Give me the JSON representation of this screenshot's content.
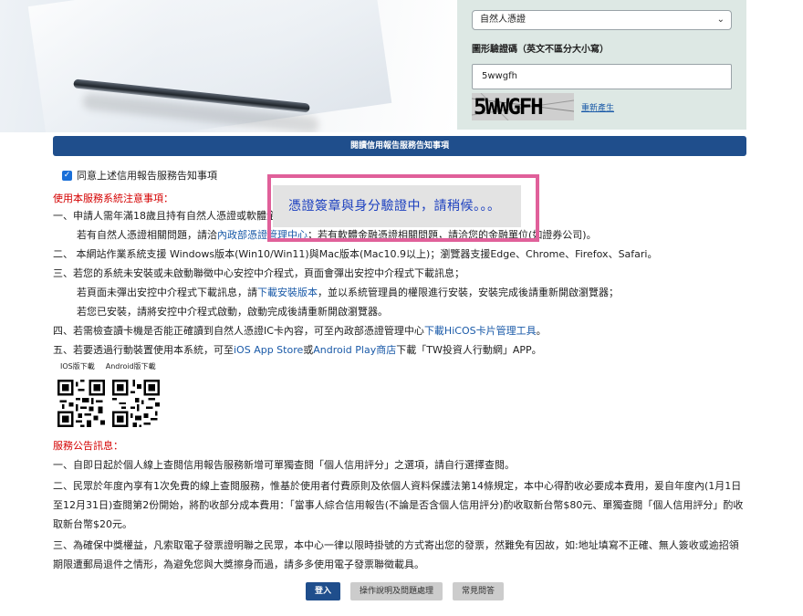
{
  "login": {
    "certificate_type": "自然人憑證",
    "captcha_label": "圖形驗證碼（英文不區分大小寫）",
    "captcha_value": "5wwgfh",
    "captcha_image_text": "5WWGFH",
    "regenerate_label": "重新產生"
  },
  "notice_bar": "閱讀信用報告服務告知事項",
  "agree_label": "同意上述信用報告服務告知事項",
  "system_notes": {
    "title": "使用本服務系統注意事項：",
    "lines": [
      "一、申請人需年滿18歲且持有自然人憑證或軟體金融",
      "若有自然人憑證相關問題，請洽",
      "內政部憑證管理中心",
      "；若有軟體金融憑證相關問題，請洽您的金融單位(如證券公司)。",
      "二、 本網站作業系統支援 Windows版本(Win10/Win11)與Mac版本(Mac10.9以上)；瀏覽器支援Edge、Chrome、Firefox、Safari。",
      "三、若您的系統未安裝或未啟動聯徵中心安控中介程式，頁面會彈出安控中介程式下載訊息；",
      "若頁面未彈出安控中介程式下載訊息，請",
      "下載安裝版本",
      "，並以系統管理員的權限進行安裝，安裝完成後請重新開啟瀏覽器；",
      "若您已安裝，請將安控中介程式啟動，啟動完成後請重新開啟瀏覽器。",
      "四、若需檢查讀卡機是否能正確讀到自然人憑證IC卡內容，可至內政部憑證管理中心",
      "下載HiCOS卡片管理工具",
      "。",
      "五、若要透過行動裝置使用本系統，可至",
      "iOS App Store",
      "或",
      "Android Play商店",
      "下載「TW投資人行動網」APP。"
    ]
  },
  "qr": {
    "ios_label": "IOS版下載",
    "android_label": "Android版下載"
  },
  "service_notes": {
    "title": "服務公告訊息：",
    "lines": [
      "一、自即日起於個人線上查閱信用報告服務新增可單獨查閱「個人信用評分」之選項，請自行選擇查閱。",
      "二、民眾於年度內享有1次免費的線上查閱服務，惟基於使用者付費原則及依個人資料保護法第14條規定，本中心得酌收必要成本費用，爰自年度內(1月1日至12月31日)查閱第2份開始，將酌收部分成本費用：「當事人綜合信用報告(不論是否含個人信用評分)酌收取新台幣$80元、單獨查閱「個人信用評分」酌收取新台幣$20元。",
      "三、為確保中獎權益，凡索取電子發票證明聯之民眾，本中心一律以限時掛號的方式寄出您的發票，然難免有因故，如:地址填寫不正確、無人簽收或逾招領期限遭郵局退件之情形，為避免您與大獎擦身而過，請多多使用電子發票聯徵載具。"
    ]
  },
  "loading_message": "憑證簽章與身分驗證中，請稍候。。。",
  "buttons": {
    "login": "登入",
    "help": "操作說明及問題處理",
    "faq": "常見問答"
  },
  "colors": {
    "brand_blue": "#1f4e8c",
    "panel_bg": "#dde8e4",
    "alert_red": "#d40000",
    "link_blue": "#1a5aa8",
    "overlay_border": "#e0609a",
    "loading_text": "#1b3fbf"
  }
}
